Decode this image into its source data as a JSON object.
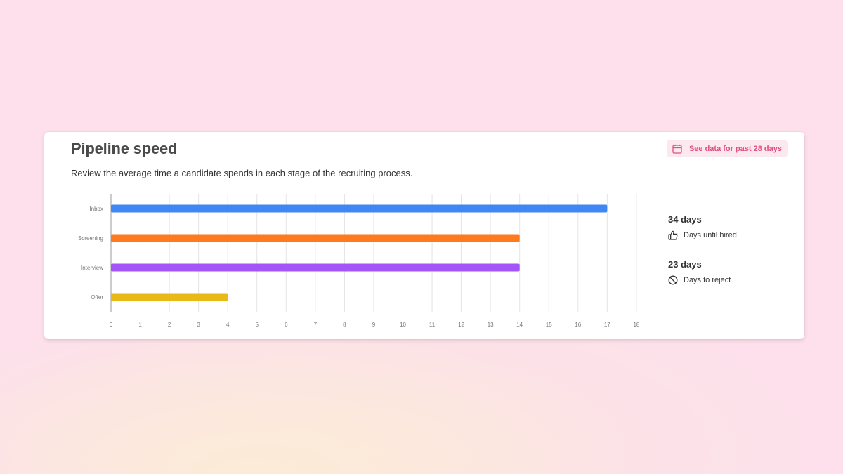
{
  "card": {
    "title": "Pipeline speed",
    "subtitle": "Review the average time a candidate spends in each stage of the recruiting process.",
    "date_button": {
      "label": "See data for past 28 days",
      "icon": "calendar-icon",
      "color": "#e0507f"
    }
  },
  "chart_data": {
    "type": "bar",
    "orientation": "horizontal",
    "categories": [
      "Inbox",
      "Screening",
      "Interview",
      "Offer"
    ],
    "values": [
      17,
      14,
      14,
      4
    ],
    "colors": [
      "#3f87f5",
      "#ff7a1f",
      "#a355f7",
      "#eab817"
    ],
    "xlim": [
      0,
      18
    ],
    "xticks": [
      0,
      1,
      2,
      3,
      4,
      5,
      6,
      7,
      8,
      9,
      10,
      11,
      12,
      13,
      14,
      15,
      16,
      17,
      18
    ],
    "title": "",
    "xlabel": "",
    "ylabel": "",
    "grid": "vertical"
  },
  "stats": [
    {
      "value": "34 days",
      "label": "Days until hired",
      "icon": "thumbs-up-icon"
    },
    {
      "value": "23 days",
      "label": "Days to reject",
      "icon": "block-icon"
    }
  ]
}
